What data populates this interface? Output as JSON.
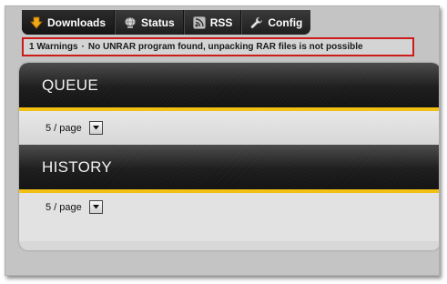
{
  "nav": {
    "items": [
      {
        "label": "Downloads",
        "icon": "download-arrow-icon",
        "active": true
      },
      {
        "label": "Status",
        "icon": "status-globe-icon",
        "active": false
      },
      {
        "label": "RSS",
        "icon": "rss-icon",
        "active": false
      },
      {
        "label": "Config",
        "icon": "wrench-icon",
        "active": false
      }
    ]
  },
  "warning": {
    "count": "1 Warnings",
    "separator": "·",
    "message": "No UNRAR program found, unpacking RAR files is not possible"
  },
  "queue": {
    "title": "QUEUE",
    "per_page": "5 / page"
  },
  "history": {
    "title": "HISTORY",
    "per_page": "5 / page"
  },
  "colors": {
    "accent": "#f2c012",
    "warning_border": "#cc1b1b",
    "nav_bg": "#1e1e1e"
  }
}
